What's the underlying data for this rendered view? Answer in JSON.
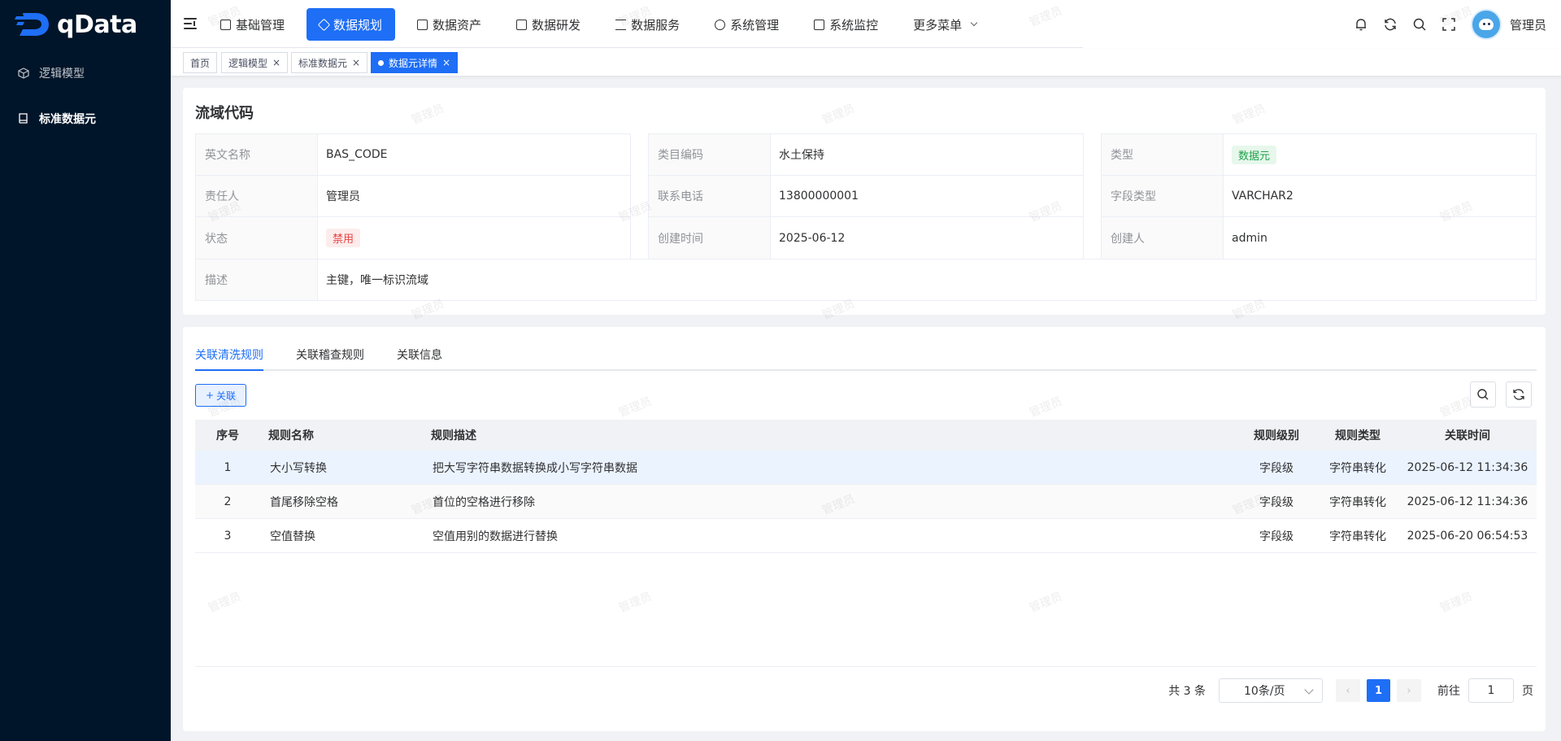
{
  "app": {
    "logo_text": "qData"
  },
  "sidebar": {
    "items": [
      {
        "label": "逻辑模型",
        "icon": "cube-icon",
        "active": false
      },
      {
        "label": "标准数据元",
        "icon": "book-icon",
        "active": true
      }
    ]
  },
  "header": {
    "nav": [
      {
        "label": "基础管理",
        "icon": "grid-icon",
        "active": false
      },
      {
        "label": "数据规划",
        "icon": "layers-icon",
        "active": true
      },
      {
        "label": "数据资产",
        "icon": "document-icon",
        "active": false
      },
      {
        "label": "数据研发",
        "icon": "folder-icon",
        "active": false
      },
      {
        "label": "数据服务",
        "icon": "hourglass-icon",
        "active": false
      },
      {
        "label": "系统管理",
        "icon": "settings-icon",
        "active": false
      },
      {
        "label": "系统监控",
        "icon": "monitor-icon",
        "active": false
      },
      {
        "label": "更多菜单",
        "icon": "chevron-down-icon",
        "active": false
      }
    ],
    "user_name": "管理员"
  },
  "tags": [
    {
      "label": "首页",
      "closable": false,
      "active": false
    },
    {
      "label": "逻辑模型",
      "closable": true,
      "active": false
    },
    {
      "label": "标准数据元",
      "closable": true,
      "active": false
    },
    {
      "label": "数据元详情",
      "closable": true,
      "active": true
    }
  ],
  "detail": {
    "title": "流域代码",
    "fields": {
      "en_name_label": "英文名称",
      "en_name": "BAS_CODE",
      "category_label": "类目编码",
      "category": "水土保持",
      "type_label": "类型",
      "type": "数据元",
      "owner_label": "责任人",
      "owner": "管理员",
      "phone_label": "联系电话",
      "phone": "13800000001",
      "field_type_label": "字段类型",
      "field_type": "VARCHAR2",
      "status_label": "状态",
      "status": "禁用",
      "created_label": "创建时间",
      "created": "2025-06-12",
      "creator_label": "创建人",
      "creator": "admin",
      "desc_label": "描述",
      "desc": "主键，唯一标识流域"
    }
  },
  "rules": {
    "tabs": [
      {
        "label": "关联清洗规则",
        "active": true
      },
      {
        "label": "关联稽查规则",
        "active": false
      },
      {
        "label": "关联信息",
        "active": false
      }
    ],
    "assoc_button": "关联",
    "columns": [
      "序号",
      "规则名称",
      "规则描述",
      "规则级别",
      "规则类型",
      "关联时间"
    ],
    "rows": [
      {
        "idx": "1",
        "name": "大小写转换",
        "desc": "把大写字符串数据转换成小写字符串数据",
        "level": "字段级",
        "type": "字符串转化",
        "time": "2025-06-12 11:34:36"
      },
      {
        "idx": "2",
        "name": "首尾移除空格",
        "desc": "首位的空格进行移除",
        "level": "字段级",
        "type": "字符串转化",
        "time": "2025-06-12 11:34:36"
      },
      {
        "idx": "3",
        "name": "空值替换",
        "desc": "空值用别的数据进行替换",
        "level": "字段级",
        "type": "字符串转化",
        "time": "2025-06-20 06:54:53"
      }
    ]
  },
  "pagination": {
    "total_text": "共 3 条",
    "page_size": "10条/页",
    "current_page": "1",
    "goto_label": "前往",
    "goto_value": "1",
    "page_suffix": "页"
  },
  "watermark": "管理员",
  "colors": {
    "primary": "#1e6ef6",
    "sidebar_bg": "#001529",
    "success": "#1fa34a",
    "danger": "#e54545"
  }
}
